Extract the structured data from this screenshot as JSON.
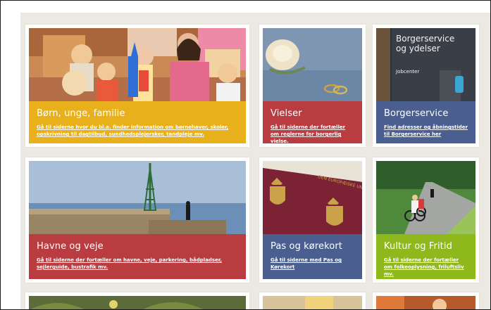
{
  "tiles": [
    {
      "title": "Børn, unge, familie",
      "description": "Gå til siderne hvor du bl.a. finder information om børnehaver, skoler, opskrivning til dagtilbud, sundhedsplejersker, tandpleje mv.",
      "color": "#e8b01a"
    },
    {
      "title": "Vielser",
      "description": "Gå til siderne der fortæller om reglerne for borgerlig vielse.",
      "color": "#b83c40"
    },
    {
      "title": "Borgerservice",
      "description": "Find adresser og åbningstider til Borgerservice her",
      "color": "#4a5e8f",
      "sign_line1": "Borgerservice",
      "sign_line2": "og ydelser",
      "sign_line3": "Jobcenter"
    },
    {
      "title": "Havne og veje",
      "description": "Gå til siderne der fortæller om havne, veje, parkering, bådpladser, sejlerguide, bustrafik mv.",
      "color": "#b83c40"
    },
    {
      "title": "Pas og kørekort",
      "description": "Gå til siderne med Pas og Kørekort",
      "color": "#4a5e8f",
      "passport_text": "DEN EUROPÆISKE UNION DANMARK"
    },
    {
      "title": "Kultur og Fritid",
      "description": "Gå til siderne der fortæller om folkeoplysning, friluftsliv mv.",
      "color": "#8fb81c"
    }
  ]
}
